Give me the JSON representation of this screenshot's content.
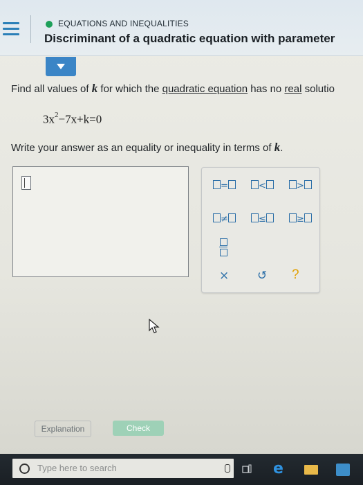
{
  "header": {
    "topic": "EQUATIONS AND INEQUALITIES",
    "title": "Discriminant of a quadratic equation with parameter"
  },
  "question": {
    "prefix": "Find all values of ",
    "variable": "k",
    "middle": " for which the ",
    "link1": "quadratic equation",
    "mid2": " has no ",
    "link2": "real",
    "suffix": " solutio"
  },
  "equation": {
    "before_exp": "3x",
    "exponent": "2",
    "after_exp": "−7x+k=0"
  },
  "instructions": {
    "prefix": "Write your answer as an equality or inequality in terms of ",
    "variable": "k",
    "suffix": "."
  },
  "keypad": {
    "ops": [
      "=",
      "<",
      ">",
      "≠",
      "≤",
      "≥"
    ],
    "clear": "×",
    "undo": "↺",
    "help": "?"
  },
  "buttons": {
    "explanation": "Explanation",
    "check": "Check"
  },
  "taskbar": {
    "search_placeholder": "Type here to search"
  },
  "colors": {
    "accent": "#3b85c6",
    "topic_dot": "#1ea05a",
    "check_button": "#9ed1b7",
    "help_icon": "#e2a100"
  }
}
